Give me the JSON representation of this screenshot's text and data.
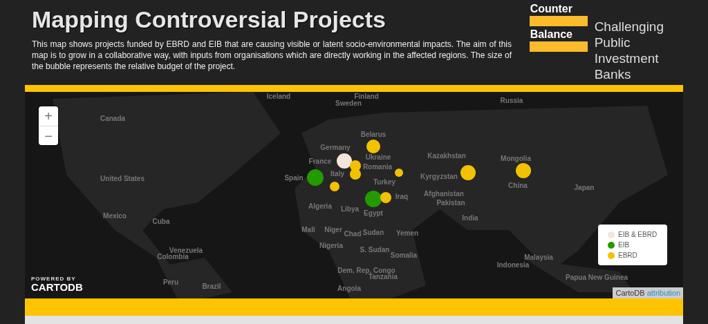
{
  "header": {
    "title": "Mapping Controversial Projects",
    "description": "This map shows projects funded by EBRD and EIB that are causing visible or latent socio-environmental impacts. The aim of this map is to grow in a collaborative way, with inputs from organisations which are directly working in the affected regions. The size of the bubble represents the relative budget of the project."
  },
  "logo": {
    "words": [
      "Counter",
      "Balance"
    ],
    "tagline": [
      "Challenging",
      "Public",
      "Investment",
      "Banks"
    ]
  },
  "map": {
    "zoom_controls": [
      "+",
      "−"
    ],
    "labels": [
      "Iceland",
      "Finland",
      "Sweden",
      "Russia",
      "Canada",
      "Germany",
      "Belarus",
      "France",
      "Ukraine",
      "Romania",
      "Italy",
      "Spain",
      "Turkey",
      "Kazakhstan",
      "Mongolia",
      "Kyrgyzstan",
      "China",
      "Japan",
      "United States",
      "Algeria",
      "Libya",
      "Egypt",
      "Iraq",
      "Afghanistan",
      "Pakistan",
      "Mexico",
      "Cuba",
      "India",
      "Mali",
      "Niger",
      "Chad",
      "Sudan",
      "Yemen",
      "Nigeria",
      "S. Sudan",
      "Somalia",
      "Venezuela",
      "Colombia",
      "Malaysia",
      "Indonesia",
      "Dem. Rep. Congo",
      "Tanzania",
      "Papua New Guinea",
      "Angola",
      "Peru",
      "Brazil"
    ],
    "markers": [
      {
        "kind": "both"
      },
      {
        "kind": "eib"
      },
      {
        "kind": "ebrd"
      },
      {
        "kind": "ebrd"
      },
      {
        "kind": "ebrd"
      },
      {
        "kind": "ebrd"
      },
      {
        "kind": "ebrd"
      },
      {
        "kind": "ebrd"
      },
      {
        "kind": "ebrd"
      },
      {
        "kind": "eib"
      },
      {
        "kind": "ebrd"
      }
    ],
    "legend": [
      {
        "kind": "both",
        "label": "EIB & EBRD",
        "color": "#f2e6dc"
      },
      {
        "kind": "eib",
        "label": "EIB",
        "color": "#229a00"
      },
      {
        "kind": "ebrd",
        "label": "EBRD",
        "color": "#f2c200"
      }
    ],
    "powered_by": "POWERED BY",
    "brand": "CARTODB",
    "attribution": {
      "text": "CartoDB",
      "link": "attribution"
    }
  }
}
